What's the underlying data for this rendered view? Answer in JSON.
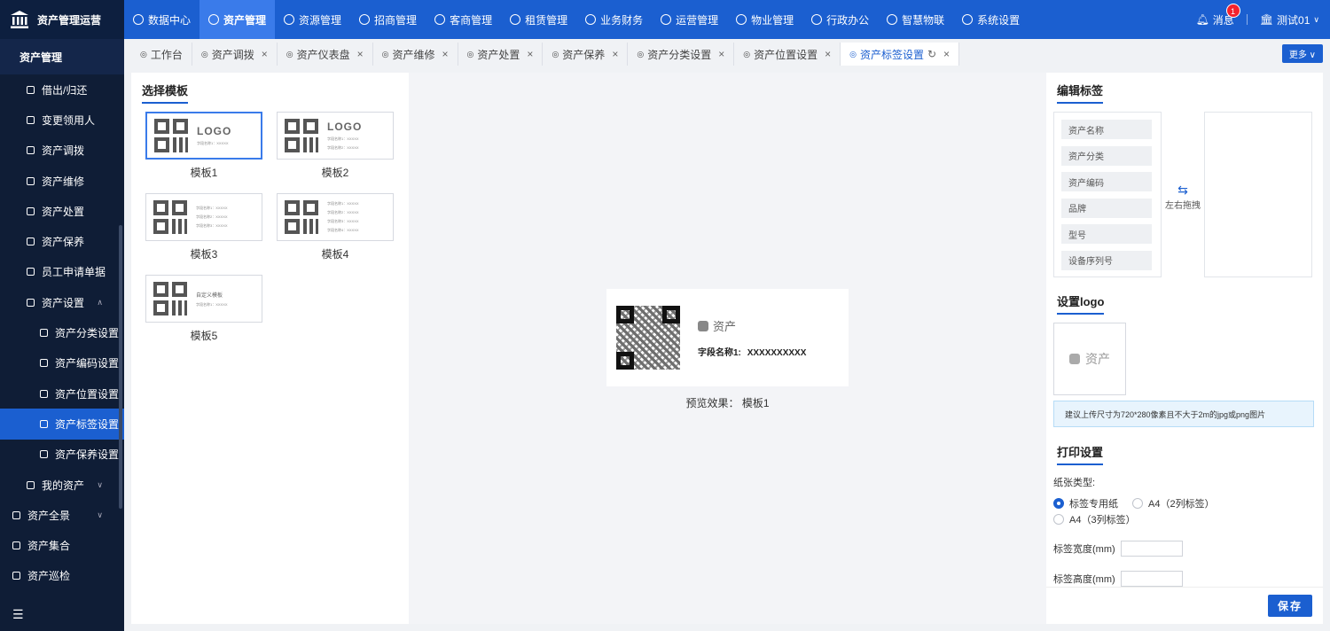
{
  "app": {
    "brand": "资产管理运营",
    "brand_color": "#1b5fd0"
  },
  "topnav": [
    {
      "label": "数据中心",
      "icon": "dashboard-icon"
    },
    {
      "label": "资产管理",
      "icon": "asset-icon",
      "active": true
    },
    {
      "label": "资源管理",
      "icon": "resource-icon"
    },
    {
      "label": "招商管理",
      "icon": "invest-icon"
    },
    {
      "label": "客商管理",
      "icon": "client-icon"
    },
    {
      "label": "租赁管理",
      "icon": "lease-icon"
    },
    {
      "label": "业务财务",
      "icon": "finance-icon"
    },
    {
      "label": "运营管理",
      "icon": "operation-icon"
    },
    {
      "label": "物业管理",
      "icon": "property-icon"
    },
    {
      "label": "行政办公",
      "icon": "office-icon"
    },
    {
      "label": "智慧物联",
      "icon": "iot-icon"
    },
    {
      "label": "系统设置",
      "icon": "settings-icon"
    }
  ],
  "header_right": {
    "messages": "消息",
    "badge": "1",
    "user": "测试01"
  },
  "sidebar": {
    "title": "资产管理",
    "items": [
      {
        "label": "借出/归还",
        "level": 1
      },
      {
        "label": "变更领用人",
        "level": 1
      },
      {
        "label": "资产调拨",
        "level": 1
      },
      {
        "label": "资产维修",
        "level": 1
      },
      {
        "label": "资产处置",
        "level": 1
      },
      {
        "label": "资产保养",
        "level": 1
      },
      {
        "label": "员工申请单据",
        "level": 1
      },
      {
        "label": "资产设置",
        "level": 1,
        "chevron": "^"
      },
      {
        "label": "资产分类设置",
        "level": 2
      },
      {
        "label": "资产编码设置",
        "level": 2
      },
      {
        "label": "资产位置设置",
        "level": 2
      },
      {
        "label": "资产标签设置",
        "level": 2,
        "active": true
      },
      {
        "label": "资产保养设置",
        "level": 2
      },
      {
        "label": "我的资产",
        "level": 1,
        "chevron": "v"
      },
      {
        "label": "资产全景",
        "level": 0,
        "chevron": "v"
      },
      {
        "label": "资产集合",
        "level": 0
      },
      {
        "label": "资产巡检",
        "level": 0
      }
    ]
  },
  "tabs": [
    {
      "label": "工作台",
      "closable": false
    },
    {
      "label": "资产调拨",
      "closable": true
    },
    {
      "label": "资产仪表盘",
      "closable": true
    },
    {
      "label": "资产维修",
      "closable": true
    },
    {
      "label": "资产处置",
      "closable": true
    },
    {
      "label": "资产保养",
      "closable": true
    },
    {
      "label": "资产分类设置",
      "closable": true
    },
    {
      "label": "资产位置设置",
      "closable": true
    },
    {
      "label": "资产标签设置",
      "closable": true,
      "active": true
    }
  ],
  "more_label": "更多",
  "template_section": {
    "title": "选择模板",
    "templates": [
      {
        "name": "模板1",
        "logo": "LOGO",
        "lines": [
          "字段名称1：XXXXX"
        ],
        "selected": true
      },
      {
        "name": "模板2",
        "logo": "LOGO",
        "lines": [
          "字段名称1：XXXXX",
          "字段名称2：XXXXX"
        ]
      },
      {
        "name": "模板3",
        "logo": "",
        "lines": [
          "字段名称1：XXXXX",
          "字段名称2：XXXXX",
          "字段名称3：XXXXX"
        ]
      },
      {
        "name": "模板4",
        "logo": "",
        "lines": [
          "字段名称1：XXXXX",
          "字段名称2：XXXXX",
          "字段名称3：XXXXX",
          "字段名称4：XXXXX"
        ]
      },
      {
        "name": "模板5",
        "logo": "自定义模板",
        "lines": [
          "字段名称1：XXXXX"
        ]
      }
    ]
  },
  "preview": {
    "logo_text": "资产",
    "field_label": "字段名称1:",
    "field_value": "XXXXXXXXXX",
    "caption_prefix": "预览效果：",
    "caption_value": "模板1"
  },
  "edit_label": {
    "title": "编辑标签",
    "fields": [
      "资产名称",
      "资产分类",
      "资产编码",
      "品牌",
      "型号",
      "设备序列号"
    ],
    "drag_hint": "左右拖拽"
  },
  "logo_section": {
    "title": "设置logo",
    "logo_text": "资产",
    "tip": "建议上传尺寸为720*280像素且不大于2m的jpg或png图片"
  },
  "print_section": {
    "title": "打印设置",
    "paper_label": "纸张类型:",
    "options": [
      {
        "label": "标签专用纸",
        "checked": true
      },
      {
        "label": "A4（2列标签）",
        "checked": false
      },
      {
        "label": "A4（3列标签）",
        "checked": false
      }
    ],
    "width_label": "标签宽度(mm)",
    "height_label": "标签高度(mm)",
    "width_value": "",
    "height_value": ""
  },
  "save_label": "保存"
}
